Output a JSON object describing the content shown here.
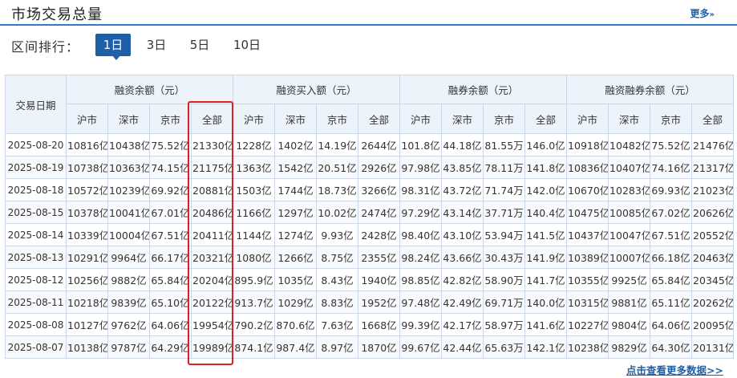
{
  "header": {
    "title": "市场交易总量",
    "more_label": "更多",
    "more_arrow": "»"
  },
  "rank": {
    "label": "区间排行：",
    "tabs": [
      "1日",
      "3日",
      "5日",
      "10日"
    ],
    "active_index": 0
  },
  "table": {
    "date_header": "交易日期",
    "groups": [
      "融资余额（元）",
      "融资买入额（元）",
      "融券余额（元）",
      "融资融券余额（元）"
    ],
    "sub_headers": [
      "沪市",
      "深市",
      "京市",
      "全部"
    ],
    "rows": [
      [
        "2025-08-20",
        "10816亿",
        "10438亿",
        "75.52亿",
        "21330亿",
        "1228亿",
        "1402亿",
        "14.19亿",
        "2644亿",
        "101.8亿",
        "44.18亿",
        "81.55万",
        "146.0亿",
        "10918亿",
        "10482亿",
        "75.52亿",
        "21476亿"
      ],
      [
        "2025-08-19",
        "10738亿",
        "10363亿",
        "74.15亿",
        "21175亿",
        "1363亿",
        "1542亿",
        "20.51亿",
        "2926亿",
        "97.98亿",
        "43.85亿",
        "78.11万",
        "141.8亿",
        "10836亿",
        "10407亿",
        "74.16亿",
        "21317亿"
      ],
      [
        "2025-08-18",
        "10572亿",
        "10239亿",
        "69.92亿",
        "20881亿",
        "1503亿",
        "1744亿",
        "18.73亿",
        "3266亿",
        "98.31亿",
        "43.72亿",
        "71.74万",
        "142.0亿",
        "10670亿",
        "10283亿",
        "69.93亿",
        "21023亿"
      ],
      [
        "2025-08-15",
        "10378亿",
        "10041亿",
        "67.01亿",
        "20486亿",
        "1166亿",
        "1297亿",
        "10.02亿",
        "2474亿",
        "97.29亿",
        "43.14亿",
        "37.71万",
        "140.4亿",
        "10475亿",
        "10085亿",
        "67.02亿",
        "20626亿"
      ],
      [
        "2025-08-14",
        "10339亿",
        "10004亿",
        "67.51亿",
        "20411亿",
        "1144亿",
        "1274亿",
        "9.93亿",
        "2428亿",
        "98.40亿",
        "43.10亿",
        "53.94万",
        "141.5亿",
        "10437亿",
        "10047亿",
        "67.51亿",
        "20552亿"
      ],
      [
        "2025-08-13",
        "10291亿",
        "9964亿",
        "66.17亿",
        "20321亿",
        "1080亿",
        "1266亿",
        "8.75亿",
        "2355亿",
        "98.24亿",
        "43.66亿",
        "30.43万",
        "141.9亿",
        "10389亿",
        "10007亿",
        "66.18亿",
        "20463亿"
      ],
      [
        "2025-08-12",
        "10256亿",
        "9882亿",
        "65.84亿",
        "20204亿",
        "895.9亿",
        "1035亿",
        "8.43亿",
        "1940亿",
        "98.85亿",
        "42.82亿",
        "58.90万",
        "141.7亿",
        "10355亿",
        "9925亿",
        "65.84亿",
        "20345亿"
      ],
      [
        "2025-08-11",
        "10218亿",
        "9839亿",
        "65.10亿",
        "20122亿",
        "913.7亿",
        "1029亿",
        "8.83亿",
        "1952亿",
        "97.48亿",
        "42.49亿",
        "69.71万",
        "140.0亿",
        "10315亿",
        "9881亿",
        "65.11亿",
        "20262亿"
      ],
      [
        "2025-08-08",
        "10127亿",
        "9762亿",
        "64.06亿",
        "19954亿",
        "790.2亿",
        "870.6亿",
        "7.63亿",
        "1668亿",
        "99.39亿",
        "42.17亿",
        "58.97万",
        "141.6亿",
        "10227亿",
        "9804亿",
        "64.06亿",
        "20095亿"
      ],
      [
        "2025-08-07",
        "10138亿",
        "9787亿",
        "64.29亿",
        "19989亿",
        "874.1亿",
        "987.4亿",
        "8.97亿",
        "1870亿",
        "99.67亿",
        "42.44亿",
        "65.63万",
        "142.1亿",
        "10238亿",
        "9829亿",
        "64.30亿",
        "20131亿"
      ]
    ]
  },
  "footer": {
    "more_data_label": "点击查看更多数据>>"
  },
  "colors": {
    "accent": "#1f5fa8",
    "header_bg": "#edf3fb",
    "border": "#c9d7e8",
    "highlight": "#e02020"
  }
}
